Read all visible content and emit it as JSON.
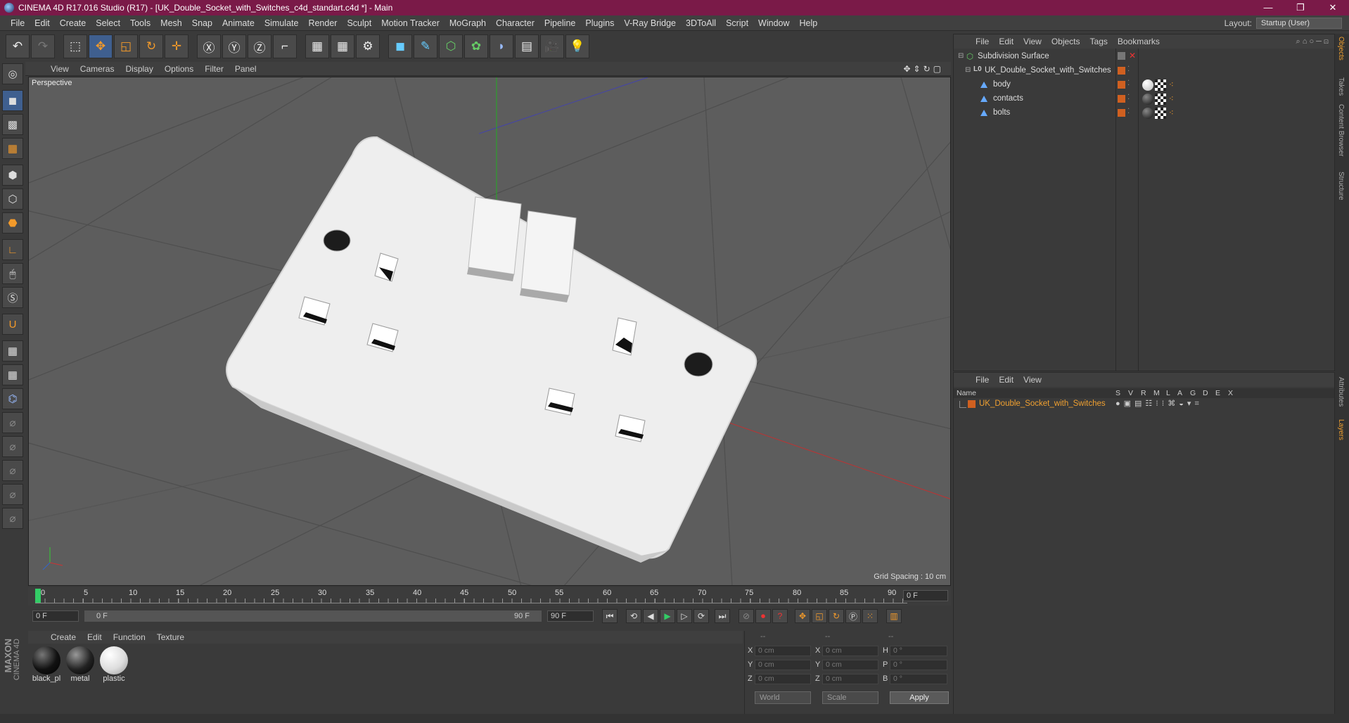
{
  "titlebar": {
    "title": "CINEMA 4D R17.016 Studio (R17) - [UK_Double_Socket_with_Switches_c4d_standart.c4d *] - Main",
    "minimize": "—",
    "maximize": "❐",
    "close": "✕"
  },
  "menubar": {
    "items": [
      "File",
      "Edit",
      "Create",
      "Select",
      "Tools",
      "Mesh",
      "Snap",
      "Animate",
      "Simulate",
      "Render",
      "Sculpt",
      "Motion Tracker",
      "MoGraph",
      "Character",
      "Pipeline",
      "Plugins",
      "V-Ray Bridge",
      "3DToAll",
      "Script",
      "Window",
      "Help"
    ],
    "layout_label": "Layout:",
    "layout_value": "Startup (User)"
  },
  "viewport": {
    "menu": [
      "View",
      "Cameras",
      "Display",
      "Options",
      "Filter",
      "Panel"
    ],
    "camera_label": "Perspective",
    "grid_spacing": "Grid Spacing : 10 cm"
  },
  "timeline": {
    "ticks": [
      "0",
      "5",
      "10",
      "15",
      "20",
      "25",
      "30",
      "35",
      "40",
      "45",
      "50",
      "55",
      "60",
      "65",
      "70",
      "75",
      "80",
      "85",
      "90"
    ],
    "current_frame": "0 F",
    "start_field": "0 F",
    "range_start": "0 F",
    "range_end": "90 F",
    "end_field": "90 F"
  },
  "materials": {
    "menu": [
      "Create",
      "Edit",
      "Function",
      "Texture"
    ],
    "items": [
      {
        "name": "black_pl",
        "color": "#111111"
      },
      {
        "name": "metal",
        "color": "#1e1e1e"
      },
      {
        "name": "plastic",
        "color": "#dddddd"
      }
    ]
  },
  "coordinates": {
    "header": [
      "--",
      "--",
      "--"
    ],
    "rows": [
      {
        "a": "X",
        "av": "0 cm",
        "b": "X",
        "bv": "0 cm",
        "c": "H",
        "cv": "0 °"
      },
      {
        "a": "Y",
        "av": "0 cm",
        "b": "Y",
        "bv": "0 cm",
        "c": "P",
        "cv": "0 °"
      },
      {
        "a": "Z",
        "av": "0 cm",
        "b": "Z",
        "bv": "0 cm",
        "c": "B",
        "cv": "0 °"
      }
    ],
    "space": "World",
    "mode": "Scale",
    "apply": "Apply"
  },
  "objects_panel": {
    "menu": [
      "File",
      "Edit",
      "View",
      "Objects",
      "Tags",
      "Bookmarks"
    ],
    "tree": [
      {
        "name": "Subdivision Surface",
        "level": 0
      },
      {
        "name": "UK_Double_Socket_with_Switches",
        "level": 1
      },
      {
        "name": "body",
        "level": 2
      },
      {
        "name": "contacts",
        "level": 2
      },
      {
        "name": "bolts",
        "level": 2
      }
    ]
  },
  "layers_panel": {
    "menu": [
      "File",
      "Edit",
      "View"
    ],
    "columns": [
      "Name",
      "S",
      "V",
      "R",
      "M",
      "L",
      "A",
      "G",
      "D",
      "E",
      "X"
    ],
    "layer_name": "UK_Double_Socket_with_Switches"
  },
  "right_tabs": [
    "Objects",
    "Takes",
    "Content Browser",
    "Structure",
    "Attributes",
    "Layers"
  ],
  "branding": {
    "maxon": "MAXON",
    "c4d": "CINEMA 4D"
  },
  "colors": {
    "titlebar": "#7a1a48",
    "accent": "#f0a030",
    "layer": "#d06020"
  }
}
